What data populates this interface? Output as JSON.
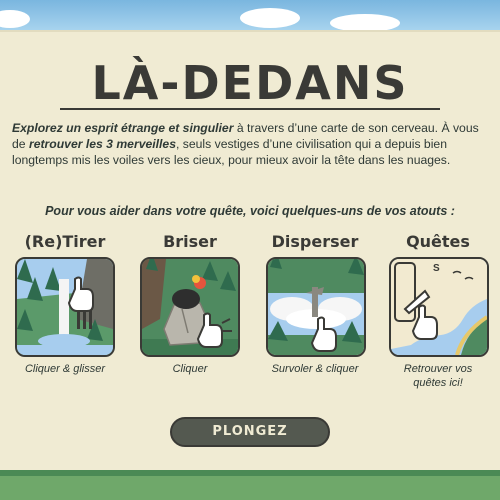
{
  "title": "LÀ-DEDANS",
  "intro": {
    "part1": "Explorez un esprit étrange et singulier",
    "part2": " à travers d’une carte de son cerveau. À vous de ",
    "part3": "retrouver les 3 merveilles",
    "part4": ", seuls vestiges d’une civilisation qui a depuis bien longtemps mis les voiles vers les cieux, pour mieux avoir la tête dans les nuages."
  },
  "subtitle": "Pour vous aider dans votre quête, voici quelques-uns de vos atouts :",
  "assets": [
    {
      "title": "(Re)Tirer",
      "caption": "Cliquer & glisser",
      "icon": "waterfall-pull-icon"
    },
    {
      "title": "Briser",
      "caption": "Cliquer",
      "icon": "break-rock-icon"
    },
    {
      "title": "Disperser",
      "caption": "Survoler & cliquer",
      "icon": "disperse-clouds-icon"
    },
    {
      "title": "Quêtes",
      "caption_line1": "Retrouver vos",
      "caption_line2": "quêtes ici!",
      "icon": "quest-map-icon",
      "compass_letter": "S"
    }
  ],
  "play_button": "PLONGEZ",
  "colors": {
    "panel": "#f0ebd3",
    "ink": "#3a3a36",
    "button": "#545950",
    "forest": "#4f8a60",
    "water": "#a7cdee"
  }
}
